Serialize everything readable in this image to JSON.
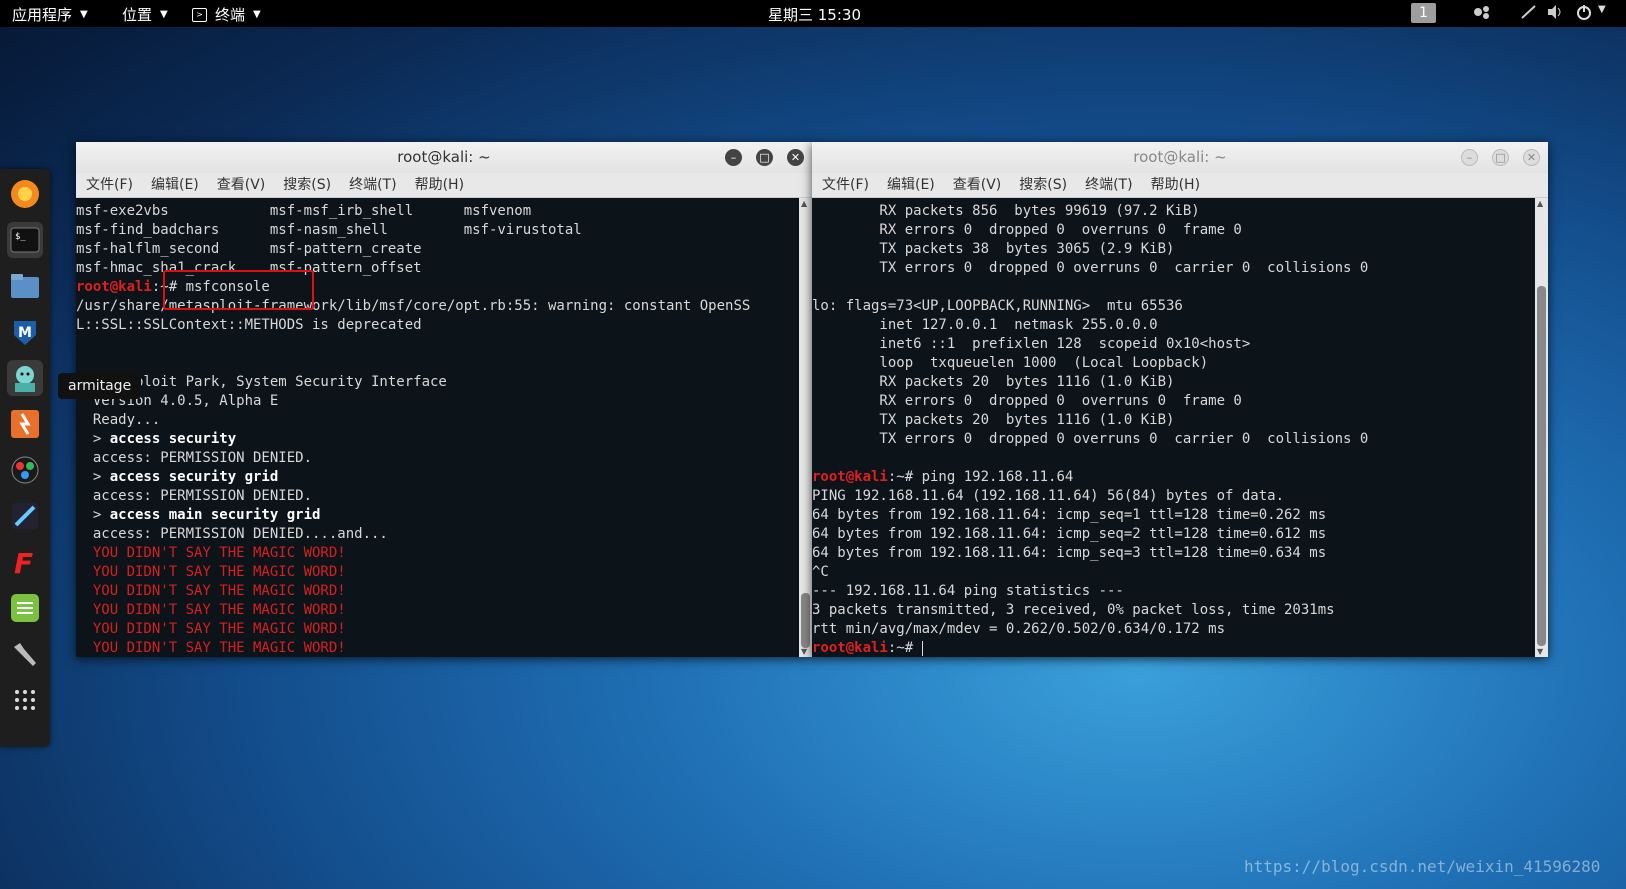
{
  "topbar": {
    "apps": "应用程序",
    "places": "位置",
    "terminal_menu": "终端",
    "clock": "星期三 15:30",
    "workspace": "1"
  },
  "dock": {
    "tooltip": "armitage",
    "items": [
      "firefox-icon",
      "terminal-icon",
      "files-icon",
      "metasploit-icon",
      "armitage-icon",
      "burpsuite-icon",
      "maltego-icon",
      "beef-icon",
      "faraday-icon",
      "leafpad-icon",
      "tools-icon",
      "apps-grid-icon"
    ]
  },
  "colors": {
    "prompt_red": "#e02020",
    "terminal_bg": "#0c1319",
    "highlight_box": "#e01010"
  },
  "left_term": {
    "title": "root@kali: ~",
    "menu": [
      "文件(F)",
      "编辑(E)",
      "查看(V)",
      "搜索(S)",
      "终端(T)",
      "帮助(H)"
    ],
    "lines": [
      "msf-exe2vbs            msf-msf_irb_shell      msfvenom",
      "msf-find_badchars      msf-nasm_shell         msf-virustotal",
      "msf-halflm_second      msf-pattern_create",
      "msf-hmac_sha1_crack    msf-pattern_offset"
    ],
    "prompt_user": "root@kali",
    "prompt_path": ":~# ",
    "command": "msfconsole",
    "warn1": "/usr/share/metasploit-framework/lib/msf/core/opt.rb:55: warning: constant OpenSS",
    "warn2": "L::SSL::SSLContext::METHODS is deprecated",
    "park": [
      "  Metasploit Park, System Security Interface",
      "  Version 4.0.5, Alpha E",
      "  Ready..."
    ],
    "cmd1": "access security",
    "resp1": "  access: PERMISSION DENIED.",
    "cmd2": "access security grid",
    "resp2": "  access: PERMISSION DENIED.",
    "cmd3": "access main security grid",
    "resp3": "  access: PERMISSION DENIED....and...",
    "magic": "  YOU DIDN'T SAY THE MAGIC WORD!",
    "gt": "  > "
  },
  "right_term": {
    "title": "root@kali: ~",
    "menu": [
      "文件(F)",
      "编辑(E)",
      "查看(V)",
      "搜索(S)",
      "终端(T)",
      "帮助(H)"
    ],
    "lines1": [
      "        RX packets 856  bytes 99619 (97.2 KiB)",
      "        RX errors 0  dropped 0  overruns 0  frame 0",
      "        TX packets 38  bytes 3065 (2.9 KiB)",
      "        TX errors 0  dropped 0 overruns 0  carrier 0  collisions 0",
      "",
      "lo: flags=73<UP,LOOPBACK,RUNNING>  mtu 65536",
      "        inet 127.0.0.1  netmask 255.0.0.0",
      "        inet6 ::1  prefixlen 128  scopeid 0x10<host>",
      "        loop  txqueuelen 1000  (Local Loopback)",
      "        RX packets 20  bytes 1116 (1.0 KiB)",
      "        RX errors 0  dropped 0  overruns 0  frame 0",
      "        TX packets 20  bytes 1116 (1.0 KiB)",
      "        TX errors 0  dropped 0 overruns 0  carrier 0  collisions 0",
      ""
    ],
    "prompt_user": "root@kali",
    "prompt_path": ":~# ",
    "ping_cmd": "ping 192.168.11.64",
    "lines2": [
      "PING 192.168.11.64 (192.168.11.64) 56(84) bytes of data.",
      "64 bytes from 192.168.11.64: icmp_seq=1 ttl=128 time=0.262 ms",
      "64 bytes from 192.168.11.64: icmp_seq=2 ttl=128 time=0.612 ms",
      "64 bytes from 192.168.11.64: icmp_seq=3 ttl=128 time=0.634 ms",
      "^C",
      "--- 192.168.11.64 ping statistics ---",
      "3 packets transmitted, 3 received, 0% packet loss, time 2031ms",
      "rtt min/avg/max/mdev = 0.262/0.502/0.634/0.172 ms"
    ]
  },
  "watermark": "https://blog.csdn.net/weixin_41596280"
}
